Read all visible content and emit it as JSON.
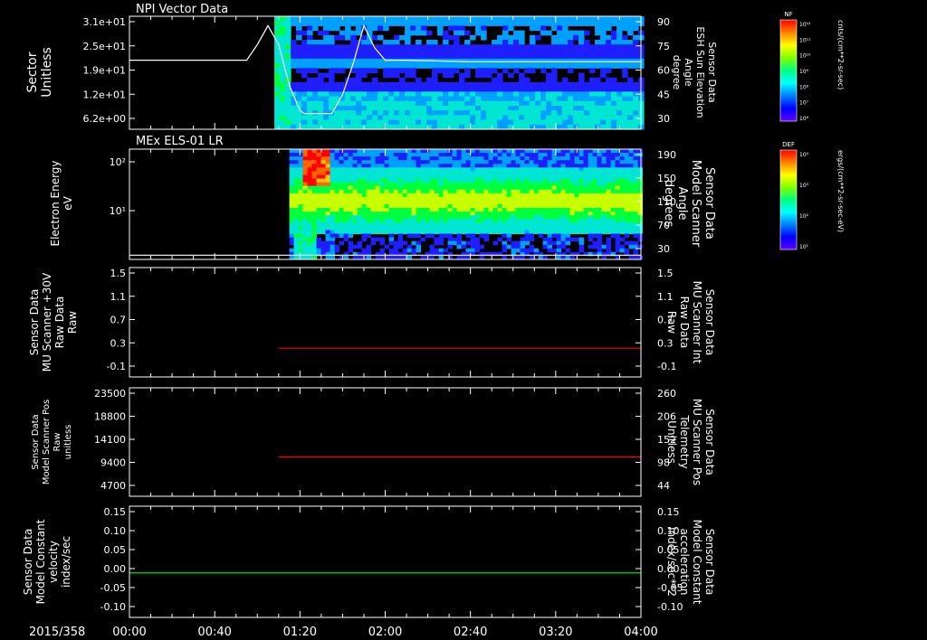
{
  "figure": {
    "date_label": "2015/358",
    "time_ticks": [
      "00:00",
      "00:40",
      "01:20",
      "02:00",
      "02:40",
      "03:20",
      "04:00"
    ],
    "time_range_minutes": [
      0,
      240
    ]
  },
  "colorbars": [
    {
      "title": "NF",
      "tick_labels": [
        "10¹²",
        "10¹¹",
        "10¹⁰",
        "10⁹",
        "10⁸",
        "10⁷",
        "10⁶"
      ],
      "unit": "cnts/(cm**2-sr-sec)"
    },
    {
      "title": "DEF",
      "tick_labels": [
        "10⁴",
        "10³",
        "10²",
        "10¹"
      ],
      "unit": "ergs/(cm**2-sr-sec-eV)"
    }
  ],
  "chart_data": [
    {
      "type": "heatmap",
      "title": "NPI Vector Data",
      "ylabel": [
        "Sector",
        "Unitless"
      ],
      "y_ticks": [
        "3.1e+01",
        "2.5e+01",
        "1.9e+01",
        "1.2e+01",
        "6.2e+00"
      ],
      "ylim": [
        0,
        31
      ],
      "y2label": [
        "Sensor Data",
        "ESH Sun Elevation",
        "Angle",
        "degree"
      ],
      "y2_ticks": [
        "90",
        "75",
        "60",
        "45",
        "30"
      ],
      "y2lim": [
        18,
        90
      ],
      "spectrogram_start_min": 68,
      "line": {
        "color": "#ffffff",
        "axis": "right",
        "x": [
          0,
          30,
          40,
          50,
          55,
          60,
          65,
          70,
          75,
          80,
          82,
          85,
          90,
          95,
          100,
          105,
          110,
          115,
          120,
          130,
          160,
          200,
          240
        ],
        "y": [
          62,
          62,
          62,
          62,
          62,
          72,
          84,
          72,
          46,
          30,
          28,
          28,
          28,
          28,
          40,
          60,
          84,
          70,
          62,
          62,
          61,
          61,
          61
        ]
      }
    },
    {
      "type": "heatmap",
      "title": "MEx ELS-01 LR",
      "ylabel": [
        "Electron Energy",
        "eV"
      ],
      "y_ticks": [
        "10²",
        "10¹"
      ],
      "y2label": [
        "Sensor Data",
        "Model Scanner",
        "Angle",
        "degrees"
      ],
      "y2_ticks": [
        "190",
        "150",
        "110",
        "70",
        "30"
      ],
      "y2lim": [
        10,
        190
      ],
      "spectrogram_start_min": 75,
      "line": {
        "color": "#ffffff",
        "axis": "right",
        "x": [
          0,
          240
        ],
        "y": [
          17,
          17
        ]
      }
    },
    {
      "type": "line",
      "ylabel": [
        "Sensor Data",
        "MU Scanner +30V",
        "Raw Data",
        "Raw"
      ],
      "y_ticks": [
        "1.5",
        "1.1",
        "0.7",
        "0.3",
        "-0.1"
      ],
      "ylim": [
        -0.4,
        1.5
      ],
      "y2label": [
        "Sensor Data",
        "MU Scanner Int",
        "Raw Data",
        "Raw"
      ],
      "y2_ticks": [
        "1.5",
        "1.1",
        "0.7",
        "0.3",
        "-0.1"
      ],
      "y2lim": [
        -0.4,
        1.5
      ],
      "series": [
        {
          "color": "#ff0000",
          "x": [
            70,
            240
          ],
          "y": [
            0.1,
            0.1
          ]
        }
      ]
    },
    {
      "type": "line",
      "ylabel": [
        "Sensor Data",
        "Model Scanner Pos",
        "Raw",
        "unitless"
      ],
      "y_ticks": [
        "23500",
        "18800",
        "14100",
        "9400",
        "4700"
      ],
      "ylim": [
        0,
        23500
      ],
      "y2label": [
        "Sensor Data",
        "MU Scanner Pos",
        "Telemetry",
        "Unitless"
      ],
      "y2_ticks": [
        "260",
        "206",
        "152",
        "98",
        "44"
      ],
      "y2lim": [
        0,
        260
      ],
      "series": [
        {
          "color": "#ff0000",
          "x": [
            70,
            240
          ],
          "y": [
            8500,
            8500
          ]
        }
      ]
    },
    {
      "type": "line",
      "ylabel": [
        "Sensor Data",
        "Model Constant",
        "velocity",
        "index/sec"
      ],
      "y_ticks": [
        "0.15",
        "0.10",
        "0.05",
        "0.00",
        "-0.05",
        "-0.10"
      ],
      "ylim": [
        -0.1,
        0.15
      ],
      "y2label": [
        "Sensor Data",
        "Model Constant",
        "acceleration",
        "index/sec**2"
      ],
      "y2_ticks": [
        "0.15",
        "0.10",
        "0.05",
        "0.00",
        "-0.05",
        "-0.10"
      ],
      "y2lim": [
        -0.1,
        0.15
      ],
      "series": [
        {
          "color": "#00ff00",
          "x": [
            0,
            240
          ],
          "y": [
            0,
            0
          ]
        }
      ]
    }
  ]
}
